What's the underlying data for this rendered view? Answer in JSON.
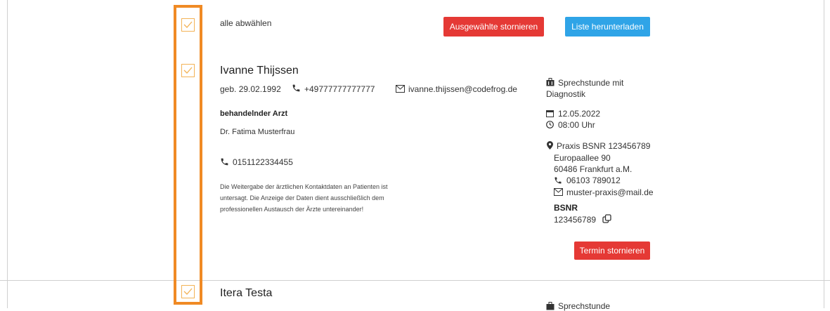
{
  "toolbar": {
    "deselect_all": "alle abwählen",
    "cancel_selected": "Ausgewählte stornieren",
    "download_list": "Liste herunterladen"
  },
  "patient1": {
    "name": "Ivanne Thijssen",
    "birth": "geb. 29.02.1992",
    "phone": "+49777777777777",
    "email": "ivanne.thijssen@codefrog.de",
    "doctor_heading": "behandelnder Arzt",
    "doctor_name": "Dr. Fatima Musterfrau",
    "doctor_phone": "0151122334455",
    "disclaimer_1": "Die Weitergabe der ärztlichen Kontaktdaten an Patienten ist",
    "disclaimer_2": "untersagt. Die Anzeige der Daten dient ausschließlich dem",
    "disclaimer_3": "professionellen Austausch der Ärzte untereinander!",
    "appt_type_1": "Sprechstunde mit",
    "appt_type_2": "Diagnostik",
    "date": "12.05.2022",
    "time": "08:00 Uhr",
    "practice": "Praxis BSNR 123456789",
    "street": "Europaallee 90",
    "city": "60486 Frankfurt a.M.",
    "practice_phone": "06103 789012",
    "practice_email": "muster-praxis@mail.de",
    "bsnr_label": "BSNR",
    "bsnr_value": "123456789",
    "cancel_button": "Termin stornieren"
  },
  "patient2": {
    "name": "Itera Testa",
    "appt_type_1": "Sprechstunde"
  },
  "colors": {
    "accent_orange": "#f08a24",
    "danger": "#e53935",
    "info": "#2fa4e7"
  },
  "icons": [
    "checkmark-icon",
    "phone-icon",
    "mail-icon",
    "briefcase-icon",
    "calendar-icon",
    "clock-icon",
    "location-pin-icon",
    "copy-icon"
  ]
}
